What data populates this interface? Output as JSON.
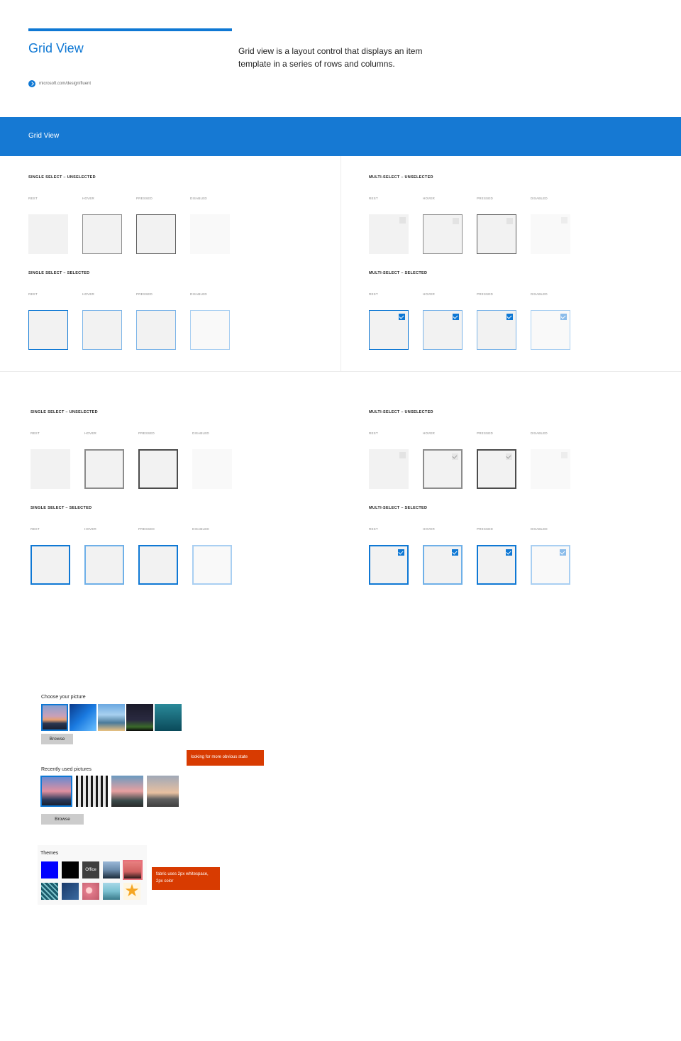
{
  "header": {
    "title": "Grid View",
    "description": "Grid view is a layout control that displays an item template in a series of rows and columns.",
    "link_text": "microsoft.com/design/fluent"
  },
  "banner": {
    "title": "Grid View"
  },
  "states": {
    "rest": "REST",
    "hover": "HOVER",
    "pressed": "PRESSED",
    "disabled": "DISABLED"
  },
  "sections": {
    "single_unselected": "SINGLE SELECT – UNSELECTED",
    "single_selected": "SINGLE SELECT – SELECTED",
    "multi_unselected": "MULTI-SELECT – UNSELECTED",
    "multi_selected": "MULTI-SELECT – SELECTED"
  },
  "examples": {
    "choose_picture": {
      "label": "Choose your picture",
      "button": "Browse"
    },
    "recent_pictures": {
      "label": "Recently used pictures",
      "button": "Browse"
    },
    "note_obvious_state": "looking for more obvious state",
    "themes": {
      "label": "Themes",
      "office_tile": "Office"
    },
    "note_fabric": "fabric uses 2px whitespace, 2px color"
  },
  "colors": {
    "accent": "#0f78d4",
    "banner": "#1679d3",
    "note": "#d83b01"
  }
}
